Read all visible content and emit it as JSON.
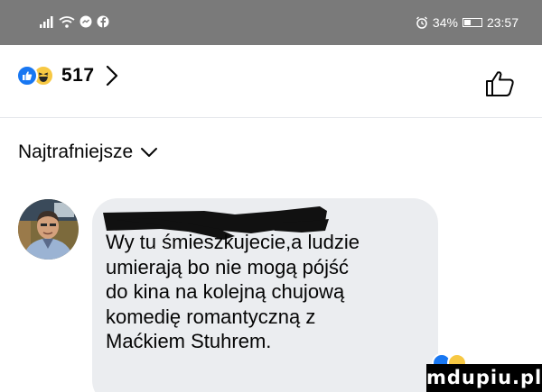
{
  "status_bar": {
    "signal_icon": "signal-bars-icon",
    "wifi_icon": "wifi-icon",
    "battery_percent": "34%",
    "battery_level": 0.34,
    "time": "23:57"
  },
  "reactions": {
    "count": "517",
    "icons": [
      "like-reaction-icon",
      "haha-reaction-icon"
    ],
    "like_color": "#1877f2",
    "haha_color": "#f7c843"
  },
  "sort": {
    "label": "Najtrafniejsze"
  },
  "comment": {
    "author_redacted": true,
    "text_lines": [
      "Wy tu śmieszkujecie,a ludzie",
      "umierają bo nie mogą pójść",
      "do kina na kolejną chujową",
      "komedię romantyczną z",
      "Maćkiem Stuhrem."
    ],
    "bubble_color": "#ebedf0"
  },
  "watermark": {
    "text": "mdupiu.pl"
  },
  "colors": {
    "status_bar_bg": "#7a7a7a",
    "accent": "#1877f2"
  }
}
